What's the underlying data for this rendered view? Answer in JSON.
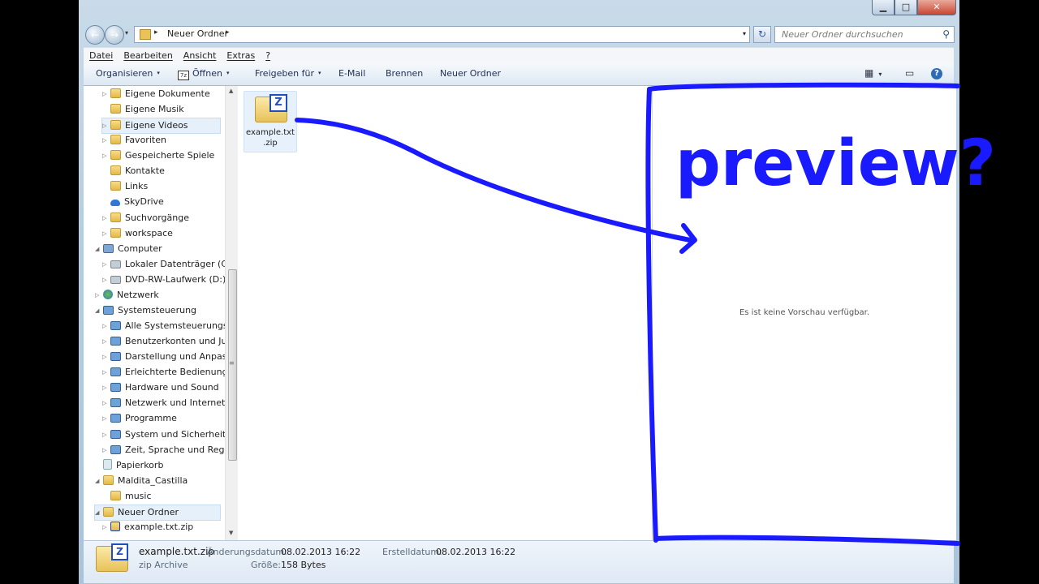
{
  "window": {
    "min_label": "▁",
    "max_label": "□",
    "close_label": "✕"
  },
  "address": {
    "back_icon": "←",
    "forward_icon": "→",
    "crumb_arrow": "▸",
    "crumb": "Neuer Ordner",
    "dropdown_icon": "▾",
    "refresh_icon": "↻",
    "search_placeholder": "Neuer Ordner durchsuchen",
    "search_icon": "⚲"
  },
  "menu": [
    "Datei",
    "Bearbeiten",
    "Ansicht",
    "Extras",
    "?"
  ],
  "toolbar": {
    "organize": "Organisieren",
    "open": "Öffnen",
    "share": "Freigeben für",
    "email": "E-Mail",
    "burn": "Brennen",
    "new_folder": "Neuer Ordner",
    "view_icon": "▦",
    "caret": "▾",
    "pane_icon": "▭",
    "help_icon": "?"
  },
  "nav": [
    {
      "label": "Eigene Dokumente",
      "indent": 2,
      "exp": "▷",
      "icon": "folder"
    },
    {
      "label": "Eigene Musik",
      "indent": 2,
      "exp": "",
      "icon": "folder"
    },
    {
      "label": "Eigene Videos",
      "indent": 2,
      "exp": "▷",
      "icon": "folder",
      "selected": true
    },
    {
      "label": "Favoriten",
      "indent": 2,
      "exp": "▷",
      "icon": "folder"
    },
    {
      "label": "Gespeicherte Spiele",
      "indent": 2,
      "exp": "▷",
      "icon": "folder"
    },
    {
      "label": "Kontakte",
      "indent": 2,
      "exp": "",
      "icon": "folder"
    },
    {
      "label": "Links",
      "indent": 2,
      "exp": "",
      "icon": "folder"
    },
    {
      "label": "SkyDrive",
      "indent": 2,
      "exp": "",
      "icon": "sky"
    },
    {
      "label": "Suchvorgänge",
      "indent": 2,
      "exp": "▷",
      "icon": "folder"
    },
    {
      "label": "workspace",
      "indent": 2,
      "exp": "▷",
      "icon": "folder"
    },
    {
      "label": "Computer",
      "indent": 1,
      "exp": "◢",
      "icon": "computer"
    },
    {
      "label": "Lokaler Datenträger (C:)",
      "indent": 2,
      "exp": "▷",
      "icon": "disk"
    },
    {
      "label": "DVD-RW-Laufwerk (D:)",
      "indent": 2,
      "exp": "▷",
      "icon": "disk"
    },
    {
      "label": "Netzwerk",
      "indent": 1,
      "exp": "▷",
      "icon": "net"
    },
    {
      "label": "Systemsteuerung",
      "indent": 1,
      "exp": "◢",
      "icon": "cpanel"
    },
    {
      "label": "Alle Systemsteuerungse",
      "indent": 2,
      "exp": "▷",
      "icon": "cpanel"
    },
    {
      "label": "Benutzerkonten und Jug",
      "indent": 2,
      "exp": "▷",
      "icon": "cpanel"
    },
    {
      "label": "Darstellung und Anpass",
      "indent": 2,
      "exp": "▷",
      "icon": "cpanel"
    },
    {
      "label": "Erleichterte Bedienung",
      "indent": 2,
      "exp": "▷",
      "icon": "cpanel"
    },
    {
      "label": "Hardware und Sound",
      "indent": 2,
      "exp": "▷",
      "icon": "cpanel"
    },
    {
      "label": "Netzwerk und Internet",
      "indent": 2,
      "exp": "▷",
      "icon": "cpanel"
    },
    {
      "label": "Programme",
      "indent": 2,
      "exp": "▷",
      "icon": "cpanel"
    },
    {
      "label": "System und Sicherheit",
      "indent": 2,
      "exp": "▷",
      "icon": "cpanel"
    },
    {
      "label": "Zeit, Sprache und Regio",
      "indent": 2,
      "exp": "▷",
      "icon": "cpanel"
    },
    {
      "label": "Papierkorb",
      "indent": 1,
      "exp": "",
      "icon": "bin"
    },
    {
      "label": "Maldita_Castilla",
      "indent": 1,
      "exp": "◢",
      "icon": "folder"
    },
    {
      "label": "music",
      "indent": 2,
      "exp": "",
      "icon": "folder"
    },
    {
      "label": "Neuer Ordner",
      "indent": 1,
      "exp": "◢",
      "icon": "folder",
      "selected": true
    },
    {
      "label": "example.txt.zip",
      "indent": 2,
      "exp": "▷",
      "icon": "zipf"
    }
  ],
  "scroll": {
    "up_icon": "▲",
    "down_icon": "▼",
    "grip_icon": "≡"
  },
  "file": {
    "name_line1": "example.txt",
    "name_line2": ".zip",
    "badge": "Z"
  },
  "preview": {
    "message": "Es ist keine Vorschau verfügbar.",
    "annotation": "preview?",
    "annotation_color": "#1a1aff"
  },
  "details": {
    "badge": "Z",
    "name": "example.txt.zip",
    "type": "zip Archive",
    "modified_label": "Änderungsdatum:",
    "modified_value": "08.02.2013 16:22",
    "size_label": "Größe:",
    "size_value": "158 Bytes",
    "created_label": "Erstelldatum:",
    "created_value": "08.02.2013 16:22"
  }
}
